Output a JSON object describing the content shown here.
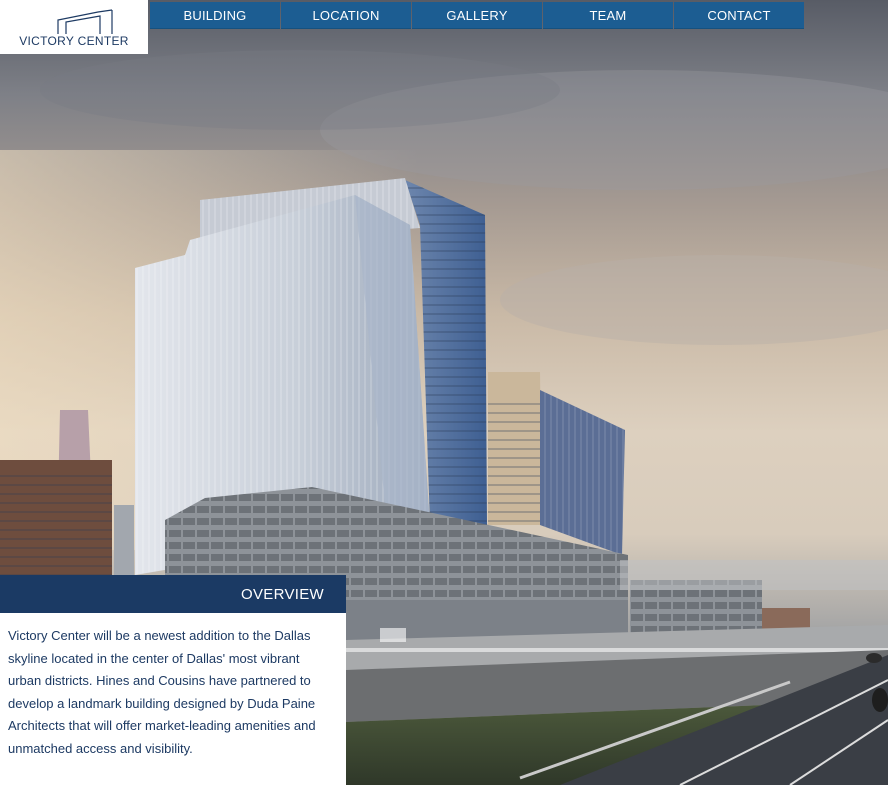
{
  "brand": {
    "name": "VICTORY CENTER",
    "logo_icon": "building-outline-icon",
    "accent_color": "#1c5d92",
    "panel_color": "#1b3a64"
  },
  "nav": {
    "items": [
      {
        "label": "BUILDING"
      },
      {
        "label": "LOCATION"
      },
      {
        "label": "GALLERY"
      },
      {
        "label": "TEAM"
      },
      {
        "label": "CONTACT"
      }
    ]
  },
  "overview": {
    "title": "OVERVIEW",
    "text": "Victory Center will be a newest addition to the Dallas skyline located in the center of Dallas' most vibrant urban districts. Hines and Cousins have partnered to develop a landmark building designed by Duda Paine Architects that will offer market-leading amenities and unmatched access and visibility."
  },
  "hero": {
    "image": "architectural-rendering-victory-center-tower"
  }
}
